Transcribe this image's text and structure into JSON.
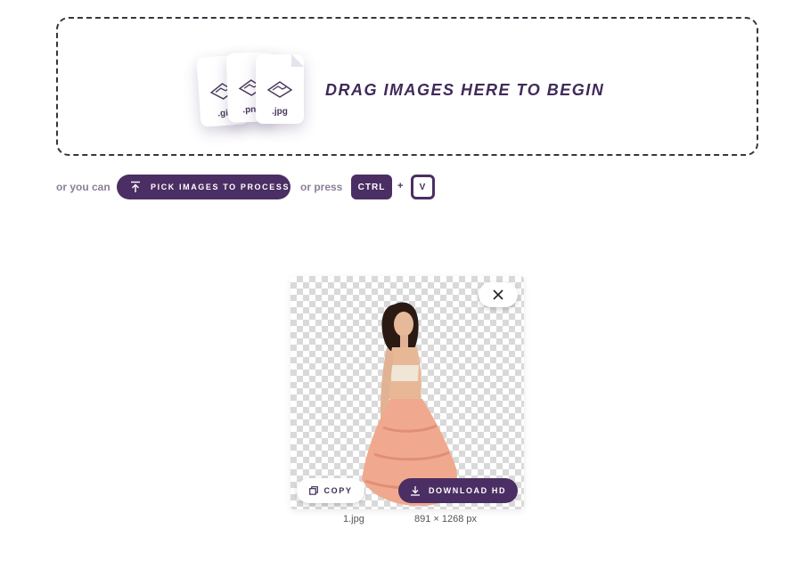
{
  "dropzone": {
    "title": "DRAG IMAGES HERE TO BEGIN",
    "file_types": [
      ".gif",
      ".png",
      ".jpg"
    ]
  },
  "actions": {
    "or_you_can": "or you can",
    "pick_label": "PICK IMAGES TO PROCESS",
    "or_press": "or press",
    "key_ctrl": "CTRL",
    "plus": "+",
    "key_v": "V"
  },
  "result": {
    "copy_label": "COPY",
    "download_label": "DOWNLOAD HD",
    "filename": "1.jpg",
    "dimensions": "891 × 1268 px"
  },
  "icons": {
    "file_cards": "image-file-icon",
    "pick": "upload-icon",
    "close": "close-icon",
    "copy": "copy-icon",
    "download": "download-icon"
  },
  "colors": {
    "accent": "#4b2e63",
    "muted_text": "#8a7f99"
  }
}
